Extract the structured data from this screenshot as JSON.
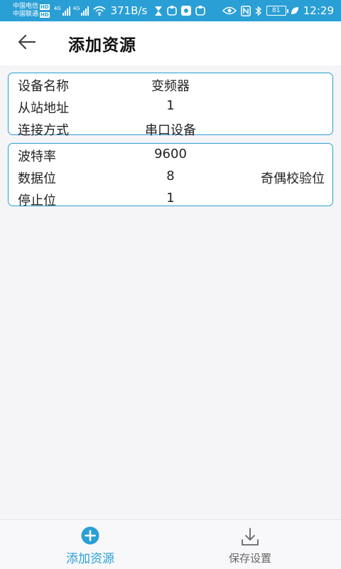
{
  "status_bar": {
    "carrier_1": "中国电信",
    "carrier_2": "中国联通",
    "hd_label": "HD",
    "network_type": "4G",
    "net_speed": "371B/s",
    "battery": "81",
    "time": "12:29"
  },
  "header": {
    "title": "添加资源"
  },
  "device_card": {
    "rows": [
      {
        "label": "设备名称",
        "value": "变频器"
      },
      {
        "label": "从站地址",
        "value": "1"
      },
      {
        "label": "连接方式",
        "value": "串口设备"
      }
    ]
  },
  "serial_card": {
    "rows": [
      {
        "label": "波特率",
        "value": "9600"
      },
      {
        "label": "数据位",
        "value": "8",
        "extra": "奇偶校验位"
      },
      {
        "label": "停止位",
        "value": "1"
      }
    ]
  },
  "bottom_nav": {
    "add_label": "添加资源",
    "save_label": "保存设置",
    "accent_color": "#2a9fd6"
  }
}
